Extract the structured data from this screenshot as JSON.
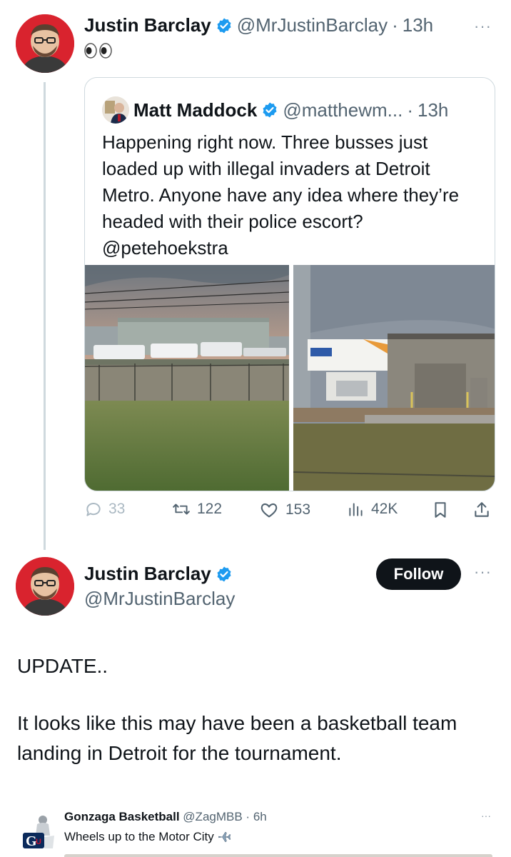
{
  "tweet1": {
    "author_name": "Justin Barclay",
    "handle": "@MrJustinBarclay",
    "time": "13h",
    "separator": "·",
    "more": "···",
    "emoji": "eyes"
  },
  "quote": {
    "author_name": "Matt Maddock",
    "handle": "@matthewm...",
    "time": "13h",
    "separator": "·",
    "text": "Happening right now. Three busses just loaded up with illegal invaders at Detroit Metro. Anyone have any idea where they’re headed with their police escort? @petehoekstra",
    "photo_left_alt": "airport-hangar-with-buses-photo",
    "photo_right_alt": "airport-building-with-plane-tail-photo"
  },
  "actions": {
    "replies": "33",
    "retweets": "122",
    "likes": "153",
    "views": "42K"
  },
  "tweet2": {
    "author_name": "Justin Barclay",
    "handle": "@MrJustinBarclay",
    "follow_label": "Follow",
    "more": "···",
    "paragraph1": "UPDATE..",
    "paragraph2": "It looks like this may have been a basketball team landing in Detroit for the tournament."
  },
  "embed": {
    "author_name": "Gonzaga Basketball",
    "handle": "@ZagMBB",
    "time": "6h",
    "separator": "·",
    "text": "Wheels up to the Motor City",
    "emoji": "airplane",
    "more": "···"
  },
  "colors": {
    "verified": "#1d9bf0",
    "avatar_bg": "#d9232e",
    "muted": "#536471",
    "follow_bg": "#0f1419"
  }
}
